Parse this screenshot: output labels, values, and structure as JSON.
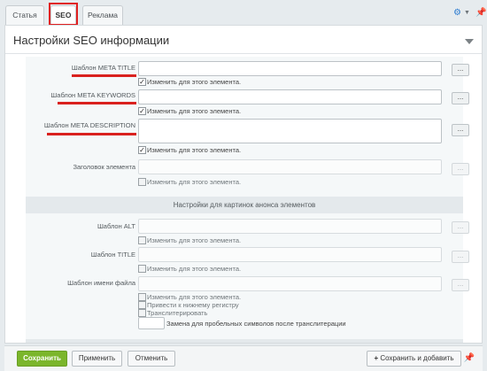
{
  "tabs": [
    {
      "label": "Статья"
    },
    {
      "label": "SEO"
    },
    {
      "label": "Реклама"
    }
  ],
  "toolbar": {
    "settings_icon": "gear-icon",
    "dropdown_icon": "chevron-down-icon",
    "pin_icon": "pin-icon"
  },
  "panel": {
    "title": "Настройки SEO информации"
  },
  "fields": {
    "meta_title": {
      "label": "Шаблон META TITLE",
      "value": "",
      "checkbox": "Изменить для этого элемента."
    },
    "meta_keywords": {
      "label": "Шаблон META KEYWORDS",
      "value": "",
      "checkbox": "Изменить для этого элемента."
    },
    "meta_description": {
      "label": "Шаблон META DESCRIPTION",
      "value": "",
      "checkbox": "Изменить для этого элемента."
    },
    "element_title": {
      "label": "Заголовок элемента",
      "value": "",
      "checkbox": "Изменить для этого элемента."
    }
  },
  "section_images": {
    "title": "Настройки для картинок анонса элементов",
    "alt": {
      "label": "Шаблон ALT",
      "checkbox": "Изменить для этого элемента."
    },
    "title_field": {
      "label": "Шаблон TITLE",
      "checkbox": "Изменить для этого элемента."
    },
    "filename": {
      "label": "Шаблон имени файла",
      "checkbox_change": "Изменить для этого элемента.",
      "checkbox_lowercase": "Привести к нижнему регистру",
      "checkbox_translit": "Транслитерировать",
      "replace_label": "Замена для пробельных символов после транслитерации"
    }
  },
  "dots_label": "...",
  "footer": {
    "save": "Сохранить",
    "apply": "Применить",
    "cancel": "Отменить",
    "save_add": "Сохранить и добавить",
    "add_icon": "+"
  },
  "colors": {
    "accent_green": "#7bb62b",
    "highlight_red": "#d9211e"
  }
}
